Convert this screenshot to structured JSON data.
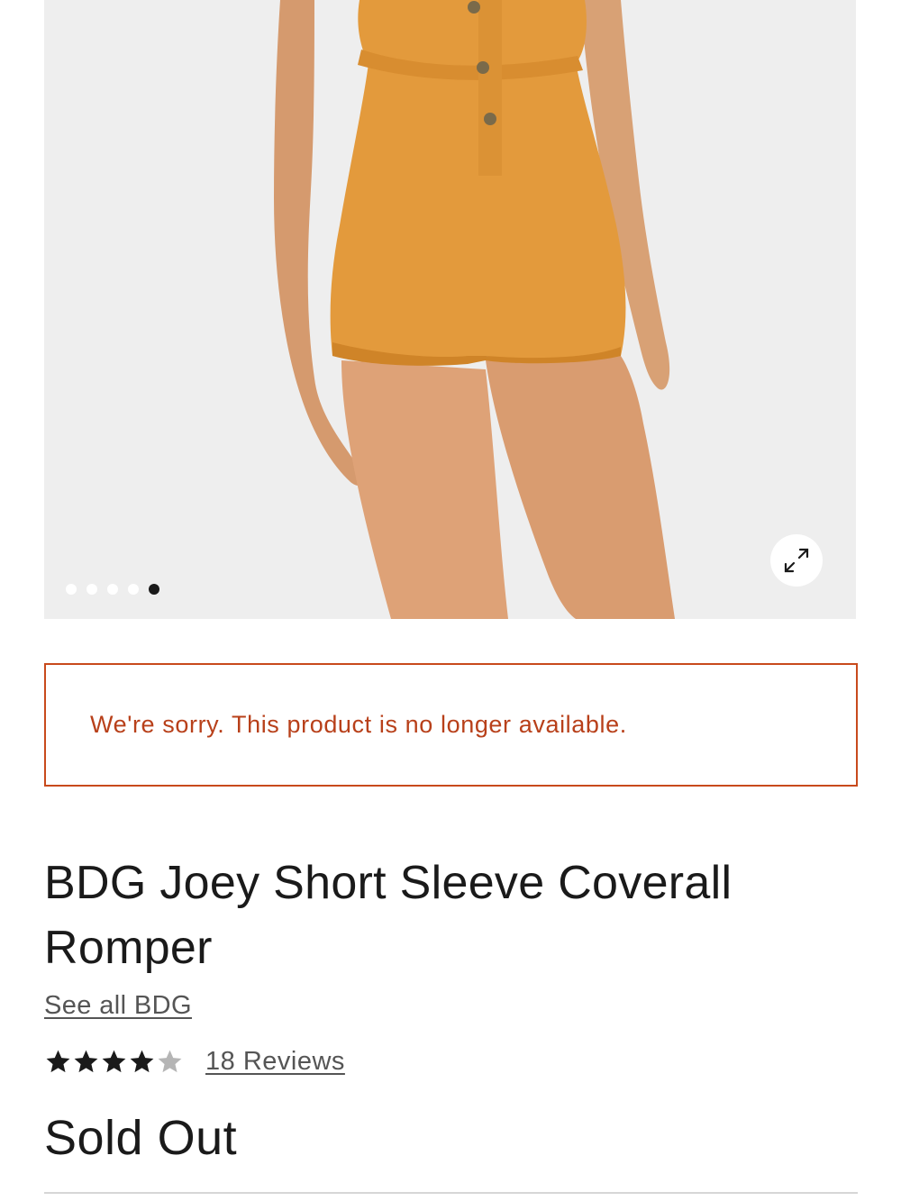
{
  "gallery": {
    "image_alt": "Model wearing mustard coverall romper",
    "slide_count": 5,
    "active_slide": 5,
    "expand_icon": "expand-arrows-icon",
    "romper_color": "#e39a3c"
  },
  "notice": {
    "message": "We're sorry. This product is no longer available.",
    "color": "#b8401a"
  },
  "product": {
    "title": "BDG Joey Short Sleeve Coverall Romper",
    "brand_link": "See all BDG",
    "rating": 4,
    "rating_max": 5,
    "reviews_label": "18 Reviews",
    "status": "Sold Out"
  }
}
